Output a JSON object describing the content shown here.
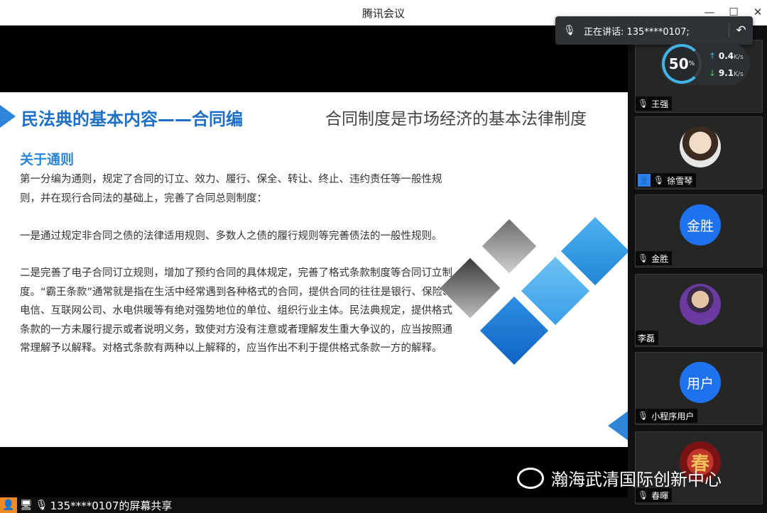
{
  "window": {
    "title": "腾讯会议",
    "minimize": "—",
    "maximize": "☐",
    "close": "✕"
  },
  "speaking": {
    "text": "正在讲话: 135****0107;",
    "mic_icon": "muted-mic-icon",
    "reply_icon": "reply-icon"
  },
  "slide": {
    "heading": "民法典的基本内容——合同编",
    "subheading": "合同制度是市场经济的基本法律制度",
    "section": "关于通则",
    "p1": "第一分编为通则，规定了合同的订立、效力、履行、保全、转让、终止、违约责任等一般性规则，并在现行合同法的基础上，完善了合同总则制度：",
    "p2": "一是通过规定非合同之债的法律适用规则、多数人之债的履行规则等完善债法的一般性规则。",
    "p3": "二是完善了电子合同订立规则，增加了预约合同的具体规定，完善了格式条款制度等合同订立制度。“霸王条款”通常就是指在生活中经常遇到各种格式的合同，提供合同的往往是银行、保险、电信、互联网公司、水电供暖等有绝对强势地位的单位、组织行业主体。民法典规定，提供格式条款的一方未履行提示或者说明义务，致使对方没有注意或者理解发生重大争议的，应当按照通常理解予以解释。对格式条款有两种以上解释的，应当作出不利于提供格式条款一方的解释。"
  },
  "network": {
    "percent": "50",
    "percent_unit": "%",
    "upload": "0.4",
    "download": "9.1",
    "unit": "K/s"
  },
  "participants": [
    {
      "name": "王强",
      "avatar_text": ""
    },
    {
      "name": "徐雪琴",
      "avatar_text": ""
    },
    {
      "name": "金胜",
      "avatar_text": "金胜"
    },
    {
      "name": "李磊",
      "avatar_text": ""
    },
    {
      "name": "小程序用户",
      "avatar_text": "用户"
    },
    {
      "name": "春暉",
      "avatar_text": "春"
    }
  ],
  "bottombar": {
    "share_text": "135****0107的屏幕共享"
  },
  "watermark": {
    "text": "瀚海武清国际创新中心"
  }
}
